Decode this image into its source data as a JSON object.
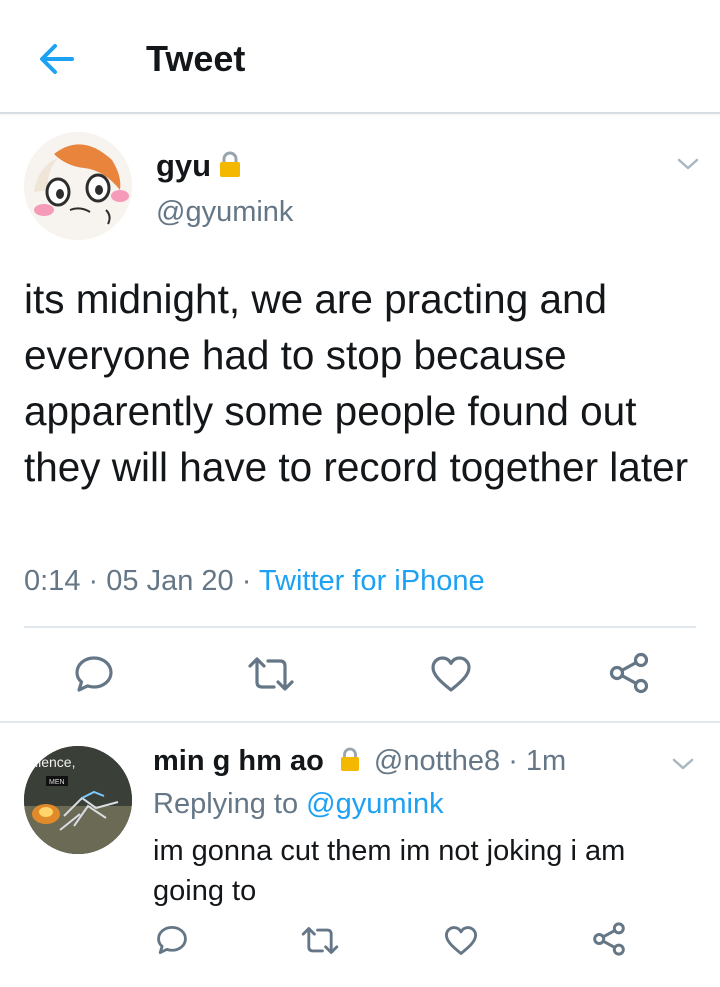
{
  "header": {
    "title": "Tweet",
    "back_icon": "arrow-left-icon",
    "accent_color": "#1da1f2"
  },
  "tweet": {
    "author": {
      "name": "gyu",
      "handle": "@gyumink",
      "protected_icon": "lock-icon"
    },
    "text": "its midnight, we are practing and everyone had to stop because apparently some people found out they will have to record together later",
    "time": "0:14",
    "date": "05 Jan 20",
    "source": "Twitter for iPhone",
    "separator": "·",
    "actions": [
      "reply-icon",
      "retweet-icon",
      "like-icon",
      "share-icon"
    ]
  },
  "reply": {
    "author": {
      "name": "min g hm ao",
      "handle": "@notthe8",
      "protected_icon": "lock-icon",
      "avatar_text_1": "silence,",
      "avatar_text_2": "MEN"
    },
    "time_ago": "1m",
    "separator": "·",
    "replying_prefix": "Replying to",
    "replying_to": "@gyumink",
    "text": "im gonna cut them im not joking i am going to",
    "actions": [
      "reply-icon",
      "retweet-icon",
      "like-icon",
      "share-icon"
    ]
  },
  "colors": {
    "text_primary": "#14171a",
    "text_secondary": "#657786",
    "link": "#1da1f2",
    "divider": "#e1e8ed",
    "lock": "#f5b800"
  }
}
